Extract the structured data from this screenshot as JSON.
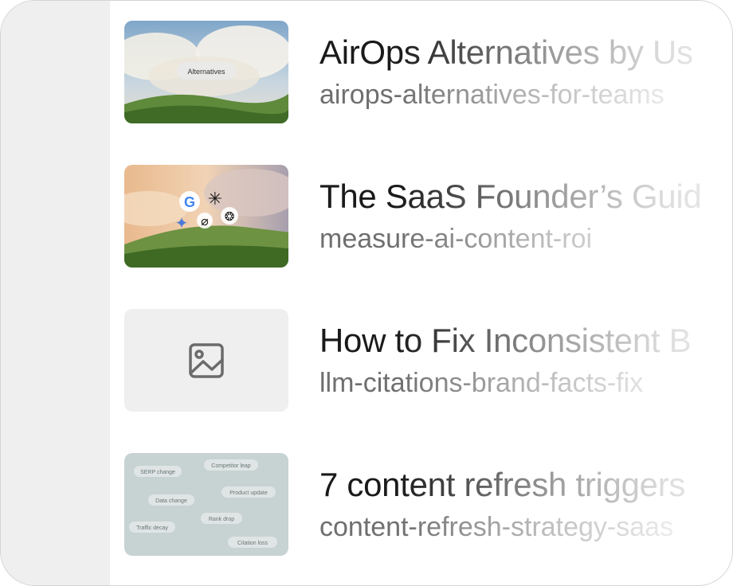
{
  "items": [
    {
      "title": "AirOps Alternatives by Us",
      "slug": "airops-alternatives-for-teams",
      "thumb_label": "Alternatives"
    },
    {
      "title": "The SaaS Founder’s Guid",
      "slug": "measure-ai-content-roi"
    },
    {
      "title": "How to Fix Inconsistent B",
      "slug": "llm-citations-brand-facts-fix",
      "thumb_icon": "image-icon"
    },
    {
      "title": "7 content refresh triggers",
      "slug": "content-refresh-strategy-saas",
      "thumb_tags": [
        "SERP change",
        "Competitor leap",
        "Data change",
        "Product update",
        "Rank drop",
        "Traffic decay",
        "Citation loss"
      ]
    }
  ]
}
